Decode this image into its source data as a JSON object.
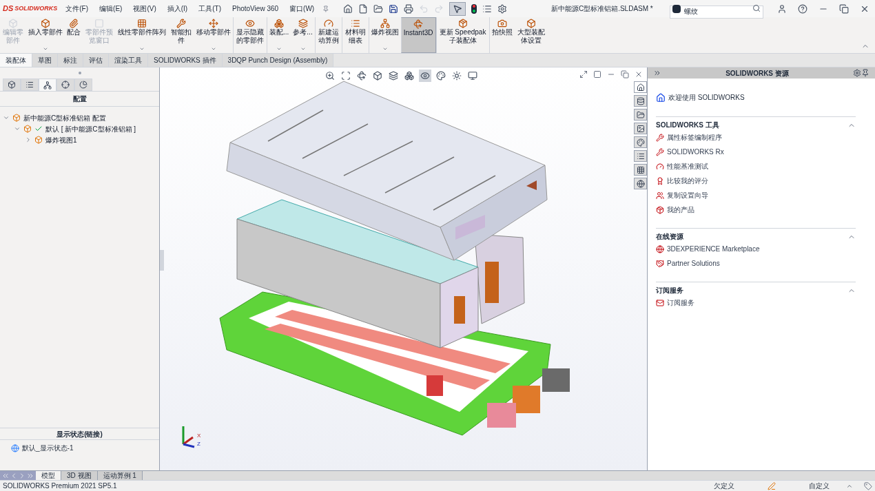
{
  "title_bar": {
    "logo_mark": "DS",
    "logo": "SOLIDWORKS",
    "menus": [
      "文件(F)",
      "编辑(E)",
      "视图(V)",
      "插入(I)",
      "工具(T)",
      "PhotoView 360",
      "窗口(W)"
    ],
    "select_tool_selected": true,
    "document_title": "新中能源C型标准铝箱.SLDASM *",
    "search": {
      "value": "螺纹"
    }
  },
  "ribbon": [
    {
      "label": "编辑零部件",
      "disabled": true,
      "dropdown": false,
      "selected": false,
      "separator_before": false
    },
    {
      "label": "插入零部件",
      "disabled": false,
      "dropdown": true,
      "selected": false,
      "separator_before": false
    },
    {
      "label": "配合",
      "disabled": false,
      "dropdown": false,
      "selected": false,
      "separator_before": false
    },
    {
      "label": "零部件预览窗口",
      "disabled": true,
      "dropdown": false,
      "selected": false,
      "separator_before": false
    },
    {
      "label": "线性零部件阵列",
      "disabled": false,
      "dropdown": true,
      "selected": false,
      "separator_before": false
    },
    {
      "label": "智能扣件",
      "disabled": false,
      "dropdown": false,
      "selected": false,
      "separator_before": false
    },
    {
      "label": "移动零部件",
      "disabled": false,
      "dropdown": true,
      "selected": false,
      "separator_before": false
    },
    {
      "label": "显示隐藏的零部件",
      "disabled": false,
      "dropdown": false,
      "selected": false,
      "separator_before": true
    },
    {
      "label": "装配...",
      "disabled": false,
      "dropdown": true,
      "selected": false,
      "separator_before": true
    },
    {
      "label": "参考...",
      "disabled": false,
      "dropdown": true,
      "selected": false,
      "separator_before": false
    },
    {
      "label": "新建运动算例",
      "disabled": false,
      "dropdown": false,
      "selected": false,
      "separator_before": true
    },
    {
      "label": "材料明细表",
      "disabled": false,
      "dropdown": false,
      "selected": false,
      "separator_before": true
    },
    {
      "label": "爆炸视图",
      "disabled": false,
      "dropdown": true,
      "selected": false,
      "separator_before": true
    },
    {
      "label": "Instant3D",
      "disabled": false,
      "dropdown": false,
      "selected": true,
      "separator_before": true
    },
    {
      "label": "更新 Speedpak子装配体",
      "disabled": false,
      "dropdown": false,
      "selected": false,
      "separator_before": true
    },
    {
      "label": "拍快照",
      "disabled": false,
      "dropdown": false,
      "selected": false,
      "separator_before": true
    },
    {
      "label": "大型装配体设置",
      "disabled": false,
      "dropdown": false,
      "selected": false,
      "separator_before": false
    }
  ],
  "tabs": [
    {
      "label": "装配体",
      "selected": true
    },
    {
      "label": "草图",
      "selected": false
    },
    {
      "label": "标注",
      "selected": false
    },
    {
      "label": "评估",
      "selected": false
    },
    {
      "label": "渲染工具",
      "selected": false
    },
    {
      "label": "SOLIDWORKS 插件",
      "selected": false
    },
    {
      "label": "3DQP Punch Design (Assembly)",
      "selected": false
    }
  ],
  "manager": {
    "tabs": [
      {
        "selected": false
      },
      {
        "selected": false
      },
      {
        "selected": true
      },
      {
        "selected": false
      },
      {
        "selected": false
      }
    ],
    "header": "配置",
    "tree": [
      {
        "label": "新中能源C型标准铝箱 配置",
        "expanded": true,
        "children": [
          {
            "label": "默认 [ 新中能源C型标准铝箱 ]",
            "expanded": true,
            "active": true,
            "children": [
              {
                "label": "爆炸视图1",
                "expanded": false
              }
            ]
          }
        ]
      }
    ],
    "display_states_header": "显示状态(链接)",
    "display_states": [
      "默认_显示状态-1"
    ]
  },
  "viewport": {
    "heads_up_tools": [
      {
        "selected": false
      },
      {
        "selected": false
      },
      {
        "selected": false
      },
      {
        "selected": false
      },
      {
        "selected": false
      },
      {
        "selected": false
      },
      {
        "selected": true
      },
      {
        "selected": false
      },
      {
        "selected": false
      },
      {
        "selected": false
      }
    ],
    "axis_x": "X",
    "axis_z": "Z"
  },
  "task_pane": {
    "title": "SOLIDWORKS 资源",
    "tabs": [
      {
        "selected": true
      },
      {
        "selected": false
      },
      {
        "selected": false
      },
      {
        "selected": false
      },
      {
        "selected": false
      },
      {
        "selected": false
      },
      {
        "selected": false
      },
      {
        "selected": false
      }
    ],
    "welcome": "欢迎使用  SOLIDWORKS",
    "sections": [
      {
        "title": "SOLIDWORKS 工具",
        "expanded": true,
        "items": [
          "属性标签编制程序",
          "SOLIDWORKS Rx",
          "性能基准测试",
          "比较我的评分",
          "复制设置向导",
          "我的产品"
        ]
      },
      {
        "title": "在线资源",
        "expanded": true,
        "items": [
          "3DEXPERIENCE Marketplace",
          "Partner Solutions"
        ]
      },
      {
        "title": "订阅服务",
        "expanded": true,
        "items": [
          "订阅服务"
        ]
      }
    ]
  },
  "bottom_tabs": [
    {
      "label": "模型",
      "selected": true
    },
    {
      "label": "3D 视图",
      "selected": false
    },
    {
      "label": "运动算例 1",
      "selected": false
    }
  ],
  "status_bar": {
    "version": "SOLIDWORKS Premium 2021 SP5.1",
    "definition": "欠定义",
    "units": "自定义"
  }
}
